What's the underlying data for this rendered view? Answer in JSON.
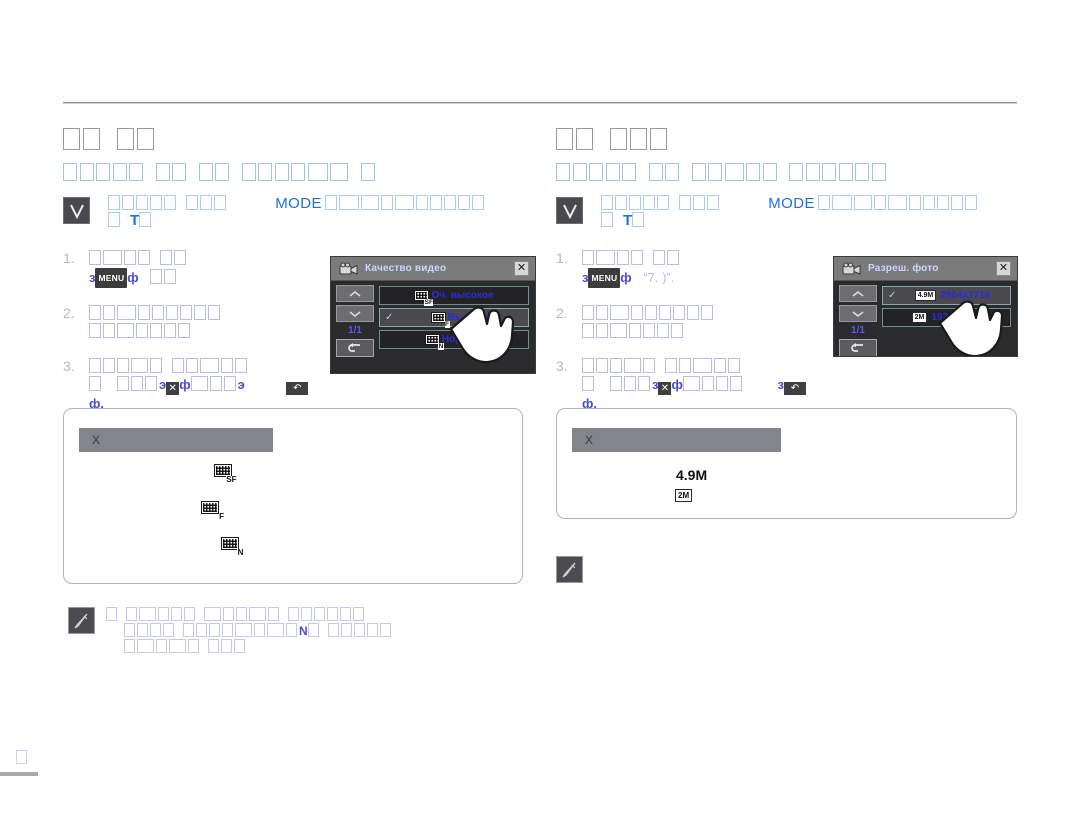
{
  "page": {
    "footer_page_number": "□"
  },
  "left_column": {
    "section_title": "□□ □□",
    "section_title_glyphs": 4,
    "subtitle_glyphs": 16,
    "precondition": {
      "icon": "checkmark-box-icon",
      "line1_pre_glyphs": 9,
      "mode_label": "MODE",
      "line1_post_glyphs": 10,
      "line2_pre_glyphs": 1,
      "line2_key": "T",
      "line2_post_glyphs": 1
    },
    "steps": [
      {
        "number": "1.",
        "line1_glyphs": 7,
        "line2_prefix": "з",
        "line2_chip": "MENU",
        "line2_key": "ф",
        "line2_post_glyphs": 2
      },
      {
        "number": "2.",
        "line1_glyphs": 9,
        "line2_glyphs": 7
      },
      {
        "number": "3.",
        "line1_glyphs": 11,
        "line2_prefix_glyphs": 4,
        "line2_mark": "э",
        "line2_chip_x": "✕",
        "line2_key": "ф",
        "line2_mid_glyphs": 3,
        "line2_mark2": "э",
        "line2_chip_back": "↶",
        "line2_end": "ф."
      }
    ],
    "lcd": {
      "title": "Качество видео",
      "title_icon": "video-camera-icon",
      "close_icon": "close-icon",
      "page_indicator": "1/1",
      "nav_up": "chevron-up-icon",
      "nav_down": "chevron-down-icon",
      "back": "back-arrow-icon",
      "options": [
        {
          "label": "Оч. высокое",
          "tag": "SF",
          "checked": false,
          "selected": false
        },
        {
          "label": "Высокое",
          "tag": "F",
          "checked": true,
          "selected": true
        },
        {
          "label": "Нормал.",
          "tag": "N",
          "checked": false,
          "selected": false
        }
      ],
      "cursor": "hand-pointer-icon"
    },
    "infobox": {
      "header_text": "X",
      "icons": [
        {
          "name": "quality-sf-icon",
          "tag": "SF"
        },
        {
          "name": "quality-f-icon",
          "tag": "F"
        },
        {
          "name": "quality-n-icon",
          "tag": "N"
        }
      ]
    },
    "note": {
      "icon": "note-pen-icon",
      "bullet": "□",
      "line1_glyphs": 11,
      "line2_pre_glyphs": 10,
      "line2_key": "N",
      "line2_post_glyphs": 5,
      "line3_glyphs": 8
    }
  },
  "right_column": {
    "section_title": "□□ □□□",
    "section_title_glyphs": 5,
    "subtitle_glyphs": 14,
    "precondition": {
      "icon": "checkmark-box-icon",
      "line1_pre_glyphs": 9,
      "mode_label": "MODE",
      "line1_post_glyphs": 10,
      "line2_pre_glyphs": 1,
      "line2_key": "T",
      "line2_post_glyphs": 1
    },
    "steps": [
      {
        "number": "1.",
        "line1_glyphs": 7,
        "line2_prefix": "з",
        "line2_chip": "MENU",
        "line2_key": "ф",
        "line2_quote": "“7. )”."
      },
      {
        "number": "2.",
        "line1_glyphs": 9,
        "line2_glyphs": 7
      },
      {
        "number": "3.",
        "line1_glyphs": 11,
        "line2_prefix_glyphs": 4,
        "line2_mark": "з",
        "line2_chip_x": "✕",
        "line2_key": "ф",
        "line2_mid_glyphs": 4,
        "line2_mark2": "з",
        "line2_chip_back": "↶",
        "line2_end": "ф."
      }
    ],
    "lcd": {
      "title": "Разреш. фото",
      "title_icon": "video-camera-icon",
      "close_icon": "close-icon",
      "page_indicator": "1/1",
      "nav_up": "chevron-up-icon",
      "nav_down": "chevron-down-icon",
      "back": "back-arrow-icon",
      "options": [
        {
          "label": "2864x1716",
          "tag": "4.9M",
          "checked": true,
          "selected": true
        },
        {
          "label": "1920x1080",
          "tag": "2M",
          "checked": false,
          "selected": false
        }
      ],
      "cursor": "hand-pointer-icon"
    },
    "infobox": {
      "header_text": "X",
      "res_primary": "4.9M",
      "res_secondary": "2M"
    },
    "note": {
      "icon": "note-pen-icon"
    }
  }
}
